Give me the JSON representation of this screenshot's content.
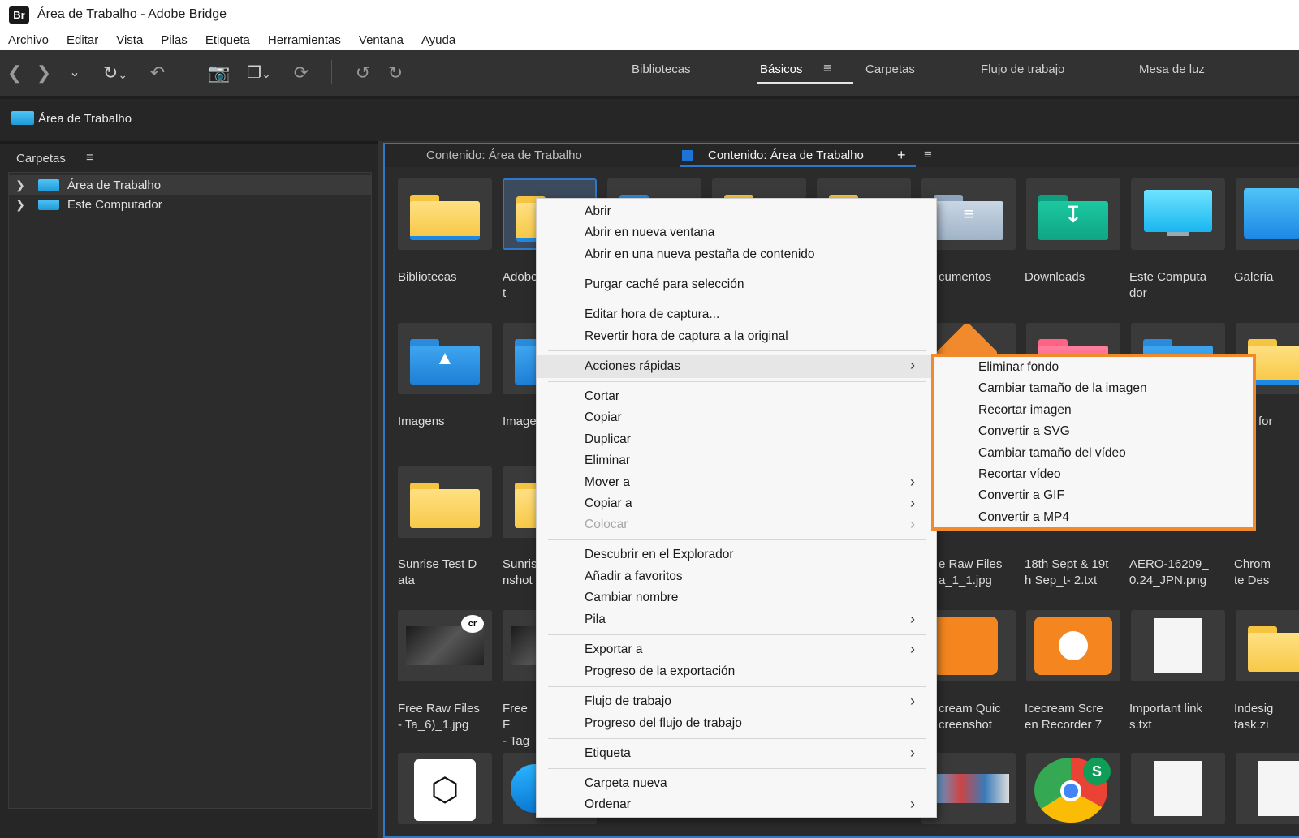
{
  "window": {
    "app_icon": "Br",
    "title": "Área de Trabalho - Adobe Bridge"
  },
  "menubar": [
    "Archivo",
    "Editar",
    "Vista",
    "Pilas",
    "Etiqueta",
    "Herramientas",
    "Ventana",
    "Ayuda"
  ],
  "toolbar": {
    "icons": [
      "back-icon",
      "forward-icon",
      "chevron-down-icon",
      "history-icon",
      "boomerang-icon",
      "camera-download-icon",
      "copy-stack-icon",
      "refine-icon",
      "rotate-left-icon",
      "rotate-right-icon"
    ],
    "workspaces": [
      "Bibliotecas",
      "Básicos",
      "Carpetas",
      "Flujo de trabajo",
      "Mesa de luz"
    ],
    "active_workspace": "Básicos"
  },
  "path": {
    "current": "Área de Trabalho"
  },
  "folders_panel": {
    "title": "Carpetas",
    "items": [
      {
        "label": "Área de Trabalho",
        "selected": true
      },
      {
        "label": "Este Computador",
        "selected": false
      }
    ]
  },
  "content_tabs": [
    {
      "label": "Contenido: Área de Trabalho",
      "active": false
    },
    {
      "label": "Contenido: Área de Trabalho",
      "active": true
    }
  ],
  "thumbnails": {
    "row1": [
      "Bibliotecas",
      "Adobe\nt",
      "",
      "",
      "",
      "cumentos",
      "Downloads",
      "Este Computa\ndor",
      "Galeria"
    ],
    "row2": [
      "Imagens",
      "Image",
      "",
      "",
      "",
      "",
      "",
      "",
      "for"
    ],
    "row3": [
      "Sunrise Test D\nata",
      "Sunris\nnshot",
      "",
      "",
      "",
      "e Raw Files\na_1_1.jpg",
      "18th Sept & 19t\nh Sep_t- 2.txt",
      "AERO-16209_\n0.24_JPN.png",
      "Chrom\nte Des"
    ],
    "row4": [
      "Free Raw Files\n- Ta_6)_1.jpg",
      "Free F\n- Tag",
      "",
      "",
      "",
      "cream Quic\ncreenshot",
      "Icecream Scre\nen Recorder 7",
      "Important link\ns.txt",
      "Indesig\ntask.zi"
    ]
  },
  "context_menu": {
    "groups": [
      [
        "Abrir",
        "Abrir en nueva ventana",
        "Abrir en una nueva pestaña de contenido"
      ],
      [
        "Purgar caché para selección"
      ],
      [
        "Editar hora de captura...",
        "Revertir hora de captura a la original"
      ],
      [
        "Acciones rápidas"
      ],
      [
        "Cortar",
        "Copiar",
        "Duplicar",
        "Eliminar",
        "Mover a",
        "Copiar a",
        "Colocar"
      ],
      [
        "Descubrir en el Explorador",
        "Añadir a favoritos",
        "Cambiar nombre",
        "Pila"
      ],
      [
        "Exportar a",
        "Progreso de la exportación"
      ],
      [
        "Flujo de trabajo",
        "Progreso del flujo de trabajo"
      ],
      [
        "Etiqueta"
      ],
      [
        "Carpeta nueva",
        "Ordenar"
      ]
    ],
    "disabled": [
      "Colocar"
    ],
    "highlighted": "Acciones rápidas"
  },
  "submenu": {
    "parent": "Acciones rápidas",
    "items": [
      "Eliminar fondo",
      "Cambiar tamaño de la imagen",
      "Recortar imagen",
      "Convertir a SVG",
      "Cambiar tamaño del vídeo",
      "Recortar vídeo",
      "Convertir a GIF",
      "Convertir a MP4"
    ],
    "highlight_color": "#f08a2c"
  },
  "colors": {
    "accent": "#2f78c8",
    "background": "#323232"
  }
}
